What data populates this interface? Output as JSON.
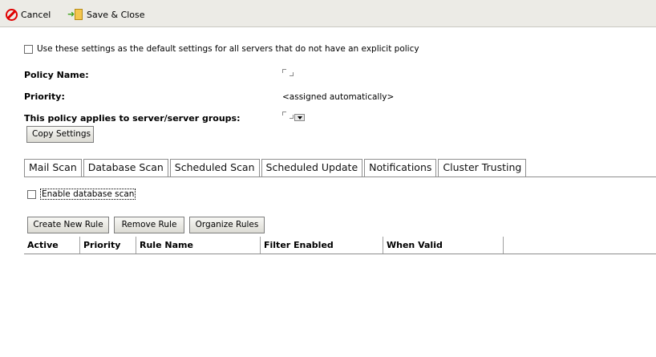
{
  "toolbar": {
    "cancel_label": "Cancel",
    "cancel_icon": "no-entry-icon",
    "save_close_label": "Save & Close",
    "save_close_icon": "save-document-icon"
  },
  "policy": {
    "default_checkbox_label": "Use these settings as the default settings for all servers that do not have an explicit policy",
    "default_checked": false,
    "name_label": "Policy Name:",
    "priority_label": "Priority:",
    "priority_value": "<assigned automatically>",
    "applies_label": "This policy applies to server/server groups:",
    "copy_settings_label": "Copy Settings"
  },
  "tabs": [
    {
      "label": "Mail Scan",
      "active": false
    },
    {
      "label": "Database Scan",
      "active": true
    },
    {
      "label": "Scheduled Scan",
      "active": false
    },
    {
      "label": "Scheduled Update",
      "active": false
    },
    {
      "label": "Notifications",
      "active": false
    },
    {
      "label": "Cluster Trusting",
      "active": false
    }
  ],
  "database_scan": {
    "enable_label": "Enable database scan",
    "enable_checked": false,
    "buttons": {
      "create": "Create New Rule",
      "remove": "Remove Rule",
      "organize": "Organize Rules"
    },
    "columns": [
      "Active",
      "Priority",
      "Rule Name",
      "Filter Enabled",
      "When Valid"
    ],
    "rows": []
  }
}
